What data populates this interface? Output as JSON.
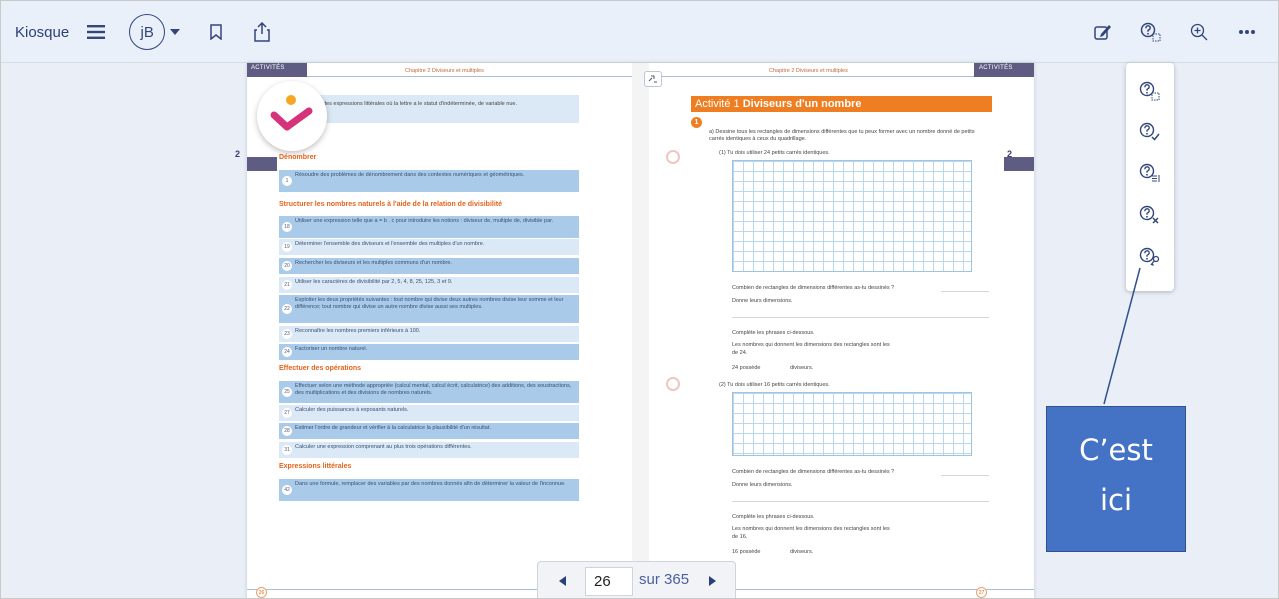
{
  "toolbar": {
    "kiosque_label": "Kiosque",
    "avatar_initials": "jB"
  },
  "book": {
    "left_header_tag": "ACTIVITÉS",
    "left_chapter": "Chapitre 2 Diviseurs et multiples",
    "right_chapter": "Chapitre 2 Diviseurs et multiples",
    "right_header_tag": "ACTIVITÉS",
    "chapter_number": "2",
    "intro_text": "des expressions littérales où la lettre a le statut d'indéterminée, de variable nue.",
    "sections": [
      {
        "title": "Dénombrer"
      },
      {
        "title": "Structurer les nombres naturels à l'aide de la relation de divisibilité"
      },
      {
        "title": "Effectuer des opérations"
      },
      {
        "title": "Expressions littérales"
      }
    ],
    "rows": [
      {
        "num": "1",
        "text": "Résoudre des problèmes de dénombrement dans des contextes numériques et géométriques."
      },
      {
        "num": "18",
        "text": "Utiliser une expression telle que a = b . c pour introduire les notions : diviseur de, multiple de, divisible par."
      },
      {
        "num": "19",
        "text": "Déterminer l'ensemble des diviseurs et l'ensemble des multiples d'un nombre."
      },
      {
        "num": "20",
        "text": "Rechercher les diviseurs et les multiples communs d'un nombre."
      },
      {
        "num": "21",
        "text": "Utiliser les caractères de divisibilité par 2, 5, 4, 8, 25, 125, 3 et 9."
      },
      {
        "num": "22",
        "text": "Exploiter les deux propriétés suivantes : tout nombre qui divise deux autres nombres divise leur somme et leur différence; tout nombre qui divise un autre nombre divise aussi ses multiples."
      },
      {
        "num": "23",
        "text": "Reconnaître les nombres premiers inférieurs à 100."
      },
      {
        "num": "24",
        "text": "Factoriser un nombre naturel."
      },
      {
        "num": "25",
        "text": "Effectuer selon une méthode appropriée (calcul mental, calcul écrit, calculatrice) des additions, des soustractions, des multiplications et des divisions de nombres naturels."
      },
      {
        "num": "27",
        "text": "Calculer des puissances à exposants naturels."
      },
      {
        "num": "28",
        "text": "Estimer l'ordre de grandeur et vérifier à la calculatrice la plausibilité d'un résultat."
      },
      {
        "num": "31",
        "text": "Calculer une expression comprenant au plus trois opérations différentes."
      },
      {
        "num": "42",
        "text": "Dans une formule, remplacer des variables par des nombres donnés afin de déterminer la valeur de l'inconnue."
      }
    ],
    "activity_prefix": "Activité 1",
    "activity_title": "Diviseurs d'un nombre",
    "activity_step": "1",
    "q_a": "a) Dessine tous les rectangles de dimensions différentes que tu peux former avec un nombre donné de petits carrés identiques à ceux du quadrillage.",
    "q_1": "(1) Tu dois utiliser 24 petits carrés identiques.",
    "q_how_many_1": "Combien de rectangles de dimensions différentes as-tu dessinés ?",
    "q_dims_1": "Donne leurs dimensions.",
    "q_complete_1": "Complète les phrases ci-dessous.",
    "q_numbers_1": "Les nombres qui donnent les dimensions des rectangles sont les",
    "q_of_1": "de 24.",
    "q_has_1a": "24 possède",
    "q_has_1b": "diviseurs.",
    "q_2": "(2) Tu dois utiliser 16 petits carrés identiques.",
    "q_how_many_2": "Combien de rectangles de dimensions différentes as-tu dessinés ?",
    "q_dims_2": "Donne leurs dimensions.",
    "q_complete_2": "Complète les phrases ci-dessous.",
    "q_numbers_2": "Les nombres qui donnent les dimensions des rectangles sont les",
    "q_of_2": "de 16.",
    "q_has_2a": "16 possède",
    "q_has_2b": "diviseurs.",
    "page_left_num": "26",
    "page_right_num": "27"
  },
  "pager": {
    "current_page": "26",
    "total_label": "sur 365"
  },
  "callout": {
    "line1": "C’est",
    "line2": "ici"
  },
  "colors": {
    "toolbar_bg": "#eaf0f9",
    "accent_orange": "#ef7d22",
    "callout_blue": "#4472c4",
    "check_pink": "#d6337a"
  }
}
